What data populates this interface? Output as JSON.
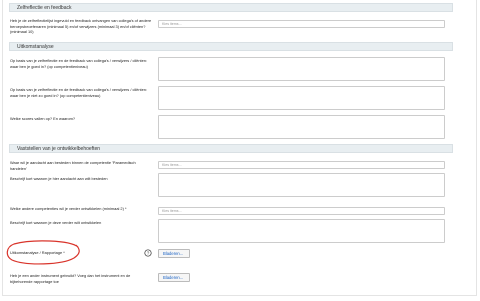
{
  "sections": {
    "zelfreflectie": "Zelfreflectie en feedback",
    "uitkomstanalyse": "Uitkomstanalyse",
    "vaststellen": "Vaststellen van je ontwikkelbehoeften"
  },
  "questions": {
    "q1": "Heb je de zelfreflectielijst ingevuld en feedback ontvangen van collega's of andere beroepsbeoefenaren (minimaal 5) en/of verwijzers (minimaal 3) en/of cliënten? (minimaal 10)",
    "q2": "Op basis van je zelfreflectie en de feedback van collega's / verwijzers / cliënten: waar ben je goed in? (op competentieniveau)",
    "q3": "Op basis van je zelfreflectie en de feedback van collega's / verwijzers / cliënten: waar ben je niet zo goed in? (op competentieniveau)",
    "q4": "Welke scores vallen op? En waarom?",
    "q5": "Waar wil je aandacht aan besteden binnen de competentie 'Paramedisch handelen'",
    "q6": "Beschrijf kort waarom je hier aandacht aan wilt besteden",
    "q7": "Welke andere competenties wil je verder ontwikkelen (minimaal 2) *",
    "q8": "Beschrijf kort waarom je deze verder wilt ontwikkelen",
    "q9": "Uitkomstanalyse / Rapportage *",
    "q10": "Heb je een ander instrument gebruikt? Voeg dan het instrument en de bijbehorende rapportage toe"
  },
  "placeholders": {
    "select": "Kies items..."
  },
  "buttons": {
    "browse": "Bladeren..."
  },
  "help_icon": "question-circle-icon",
  "colors": {
    "annotation": "#d9342b",
    "link": "#1a62c4"
  }
}
